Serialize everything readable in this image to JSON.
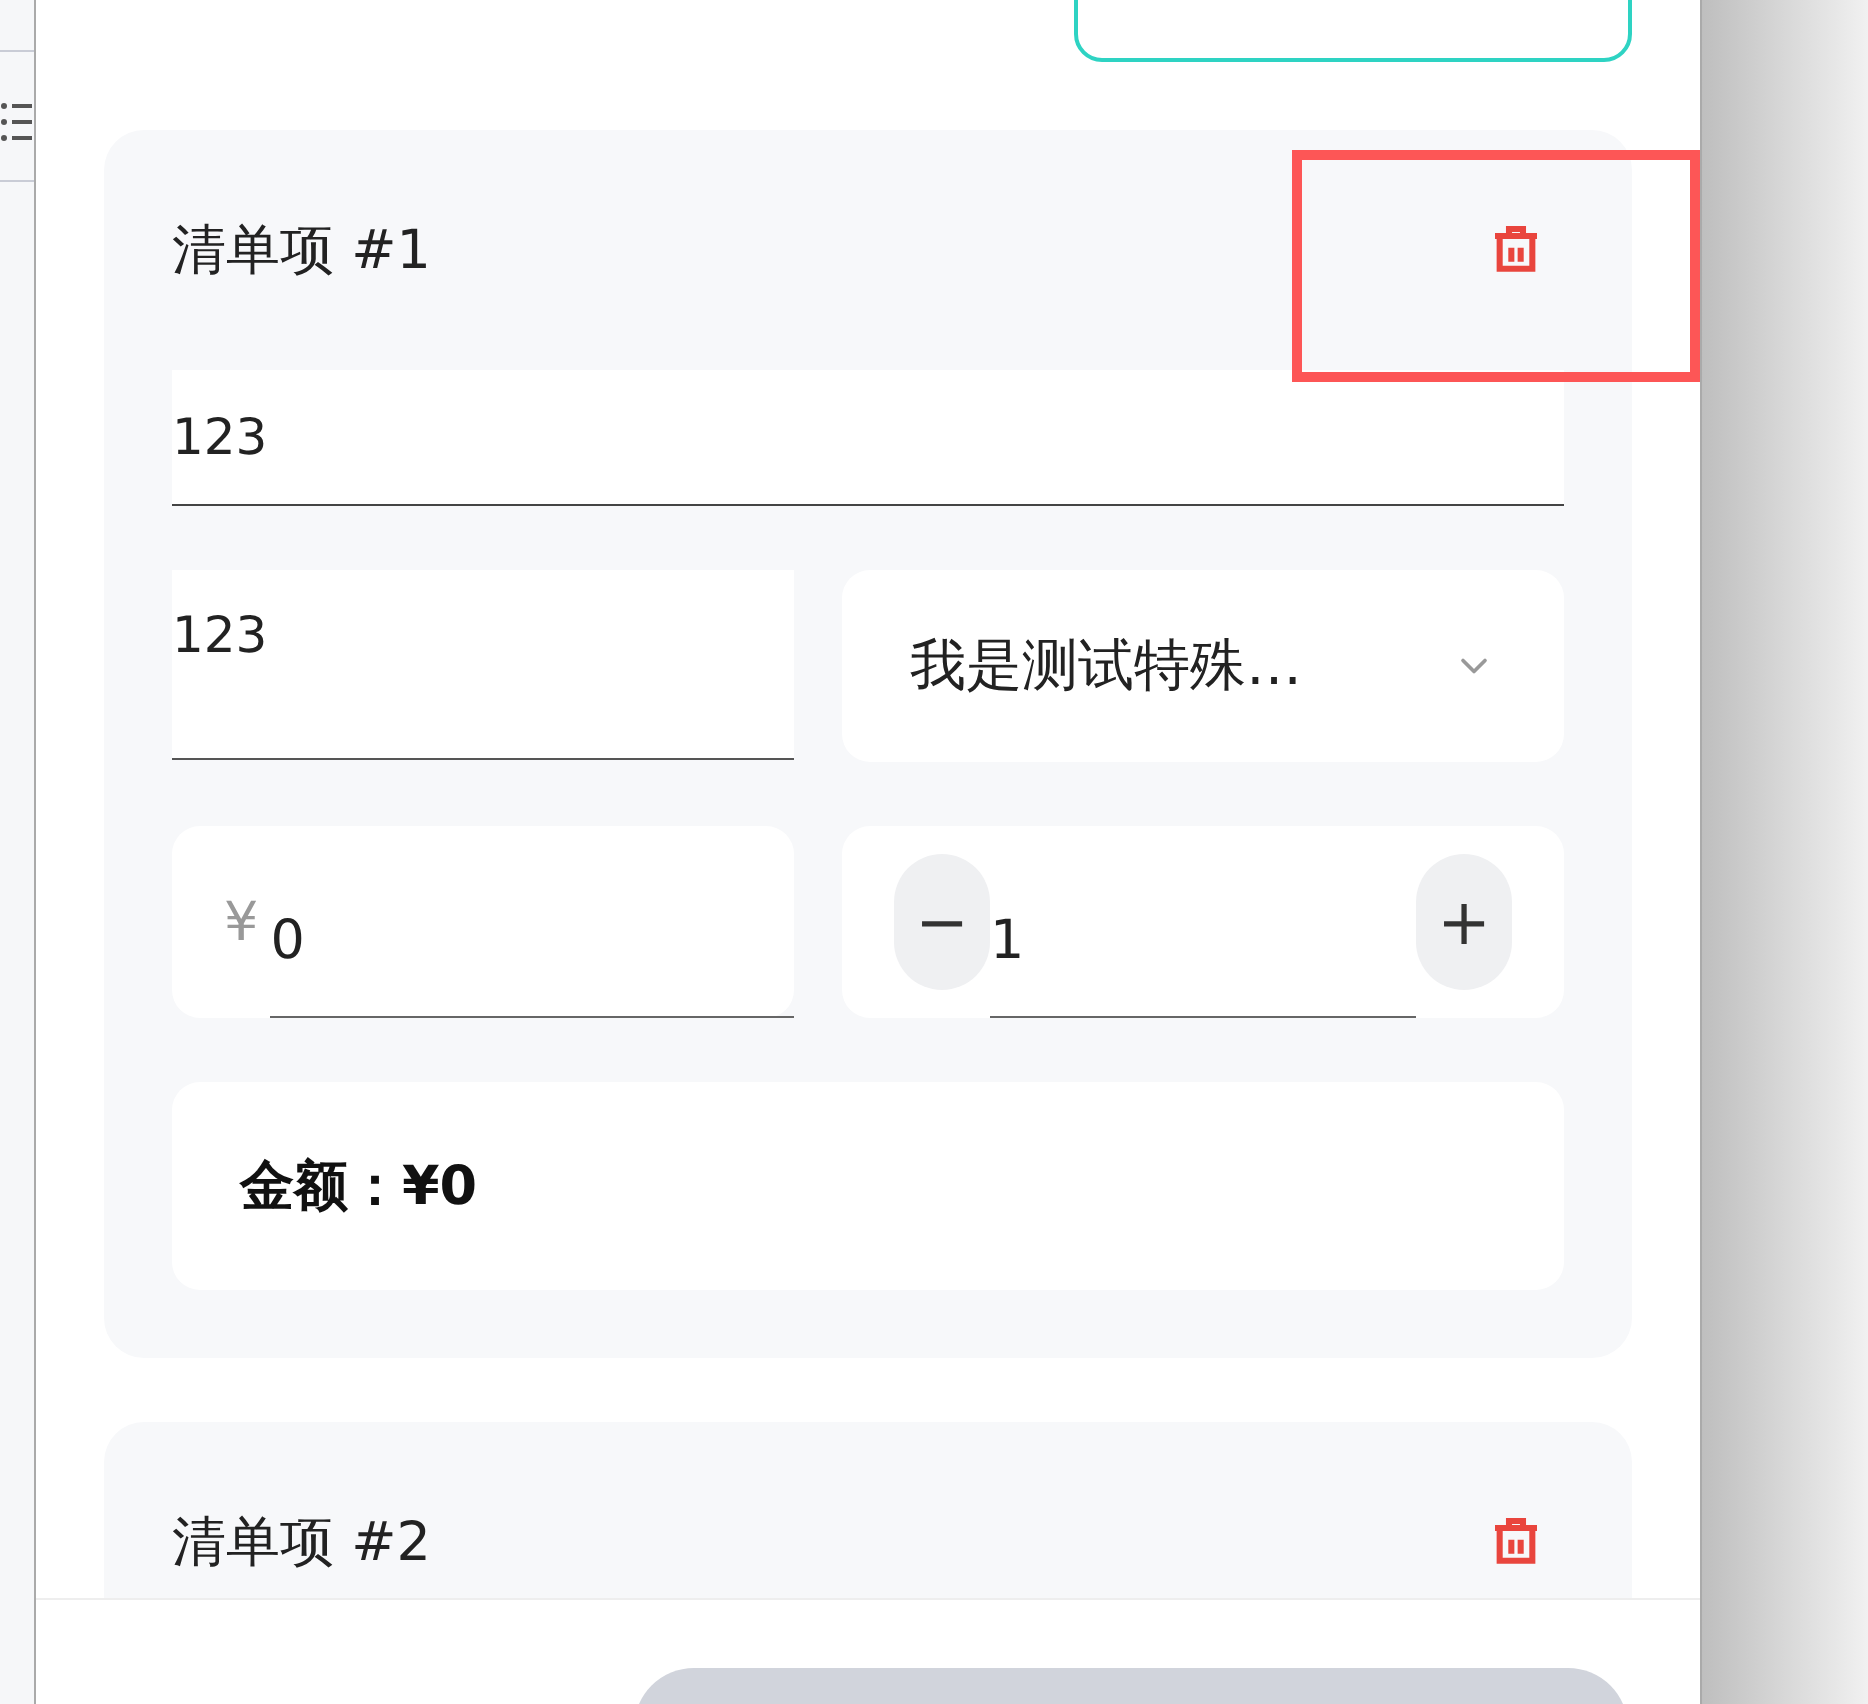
{
  "items": [
    {
      "title": "清单项 #1",
      "name": "123",
      "note": "123",
      "category": "我是测试特殊…",
      "currency": "¥",
      "price": "0",
      "quantity_minus": "−",
      "quantity": "1",
      "quantity_plus": "+",
      "amount": "**金额：¥0**",
      "highlighted": true
    },
    {
      "title": "清单项 #2",
      "highlighted": false
    }
  ]
}
